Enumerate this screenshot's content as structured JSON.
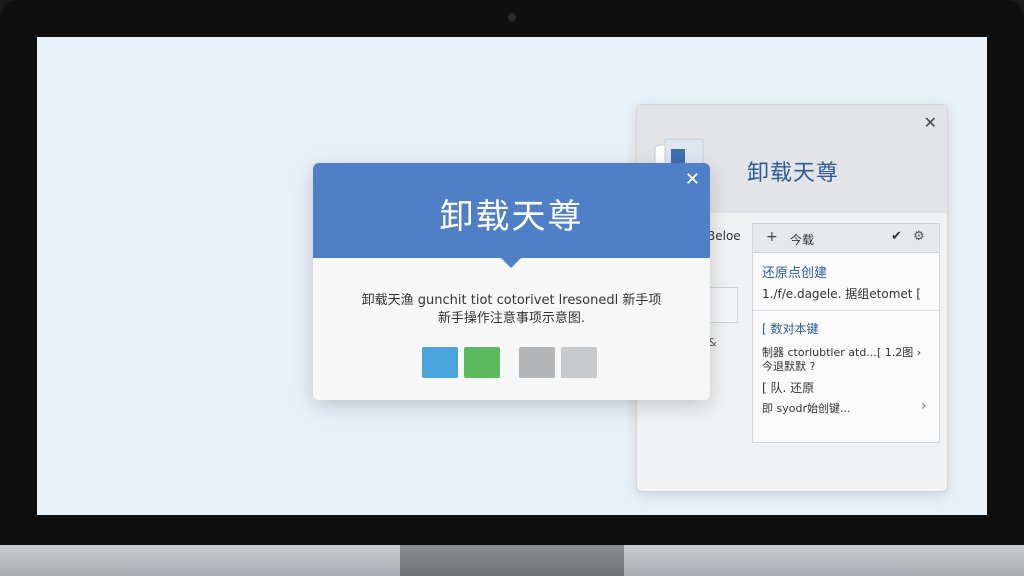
{
  "back_panel": {
    "title": "卸载天尊",
    "close_glyph": "✕",
    "left_label": "Beloe",
    "left_small": "&",
    "toolbar": {
      "plus": "+",
      "label": "今载",
      "check": "✔",
      "gear": "⚙"
    },
    "section1": {
      "title": "还原点创建",
      "text": "1./f/e.dagele. 据组etomet ["
    },
    "section2": {
      "title": "[ 数对本键",
      "line1": "制器 ctorlubtler atd...",
      "meta": "[ 1.2图 ›",
      "line2": "今退默默 ?"
    },
    "section3": {
      "title": "[ 队. 还原",
      "text": "即 syodr始创键...",
      "chevron": "›"
    }
  },
  "dialog": {
    "title": "卸载天尊",
    "close_glyph": "✕",
    "message_line1": "卸载天渔 gunchit tiot cotorivet lresonedl 新手项",
    "message_line2": "新手操作注意事项示意图.",
    "swatches": [
      "#4aa3dc",
      "#5cba5f",
      "#b4b5b7",
      "#c9cacc"
    ]
  },
  "colors": {
    "accent": "#4f7fc6",
    "title_blue": "#2e5a96",
    "screen_bg": "#e9f1f8"
  }
}
